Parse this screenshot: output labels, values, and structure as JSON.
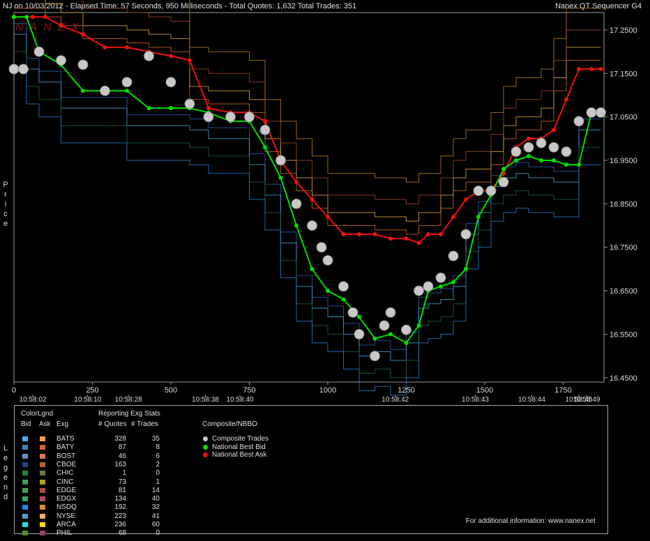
{
  "header": {
    "left": "NJ on 10/03/2012  -  Elapsed Time: 57 Seconds, 950 Milliseconds  -  Total Quotes: 1,632  Total Trades: 351",
    "right": "Nanex QT Sequencer G4"
  },
  "watermark": "NANEX",
  "side_labels": {
    "price": "P\nr\ni\nc\ne",
    "legend": "L\ne\ng\ne\nn\nd"
  },
  "colors": {
    "bid_line": "#3a7fd0",
    "ask_line": "#d86a2a",
    "trade_dot": "#c8c8c8",
    "best_bid": "#00e000",
    "best_ask": "#ee1010",
    "background": "#000000",
    "grid": "#3a3a3a"
  },
  "chart_data": {
    "type": "line",
    "ylim": [
      16.44,
      17.29
    ],
    "xlim": [
      0,
      1880
    ],
    "y_ticks": [
      "17.2500",
      "17.1500",
      "17.0500",
      "16.9500",
      "16.8500",
      "16.7500",
      "16.6500",
      "16.5500",
      "16.4500"
    ],
    "y_tick_values": [
      17.25,
      17.15,
      17.05,
      16.95,
      16.85,
      16.75,
      16.65,
      16.55,
      16.45
    ],
    "x_ticks": [
      "0",
      "250",
      "500",
      "750",
      "1000",
      "1250",
      "1500",
      "1750"
    ],
    "x_tick_values": [
      0,
      250,
      500,
      750,
      1000,
      1250,
      1500,
      1750
    ],
    "time_labels": [
      "10:58:02",
      "10:58:10",
      "10:58:28",
      "10:58:38",
      "10:58:40",
      "10:58:42",
      "10:58:43",
      "10:58:44",
      "10:58:45",
      "10:58:49"
    ],
    "time_label_x": [
      60,
      235,
      365,
      610,
      720,
      1215,
      1470,
      1650,
      1800,
      1920
    ],
    "series": [
      {
        "name": "Composite Trades",
        "x": [
          0,
          30,
          80,
          150,
          220,
          290,
          360,
          430,
          500,
          560,
          620,
          690,
          750,
          800,
          850,
          900,
          950,
          980,
          1000,
          1050,
          1080,
          1100,
          1150,
          1180,
          1200,
          1250,
          1290,
          1320,
          1360,
          1400,
          1440,
          1480,
          1520,
          1560,
          1600,
          1640,
          1680,
          1720,
          1760,
          1800,
          1840,
          1870
        ],
        "y": [
          17.16,
          17.16,
          17.2,
          17.18,
          17.17,
          17.11,
          17.13,
          17.19,
          17.13,
          17.08,
          17.05,
          17.05,
          17.05,
          17.02,
          16.95,
          16.85,
          16.8,
          16.75,
          16.72,
          16.66,
          16.6,
          16.55,
          16.5,
          16.57,
          16.6,
          16.56,
          16.65,
          16.66,
          16.68,
          16.73,
          16.78,
          16.88,
          16.88,
          16.9,
          16.97,
          16.98,
          16.99,
          16.98,
          16.97,
          17.04,
          17.06,
          17.06
        ]
      },
      {
        "name": "National Best Bid",
        "x": [
          0,
          40,
          80,
          150,
          220,
          290,
          360,
          430,
          500,
          560,
          620,
          690,
          750,
          800,
          850,
          900,
          950,
          1000,
          1050,
          1100,
          1150,
          1200,
          1250,
          1290,
          1320,
          1360,
          1400,
          1440,
          1480,
          1520,
          1560,
          1600,
          1640,
          1680,
          1720,
          1760,
          1800,
          1840,
          1870
        ],
        "y": [
          17.28,
          17.28,
          17.2,
          17.17,
          17.11,
          17.11,
          17.11,
          17.07,
          17.07,
          17.07,
          17.06,
          17.04,
          17.04,
          16.98,
          16.91,
          16.8,
          16.7,
          16.65,
          16.63,
          16.59,
          16.54,
          16.55,
          16.53,
          16.57,
          16.65,
          16.66,
          16.67,
          16.7,
          16.82,
          16.87,
          16.93,
          16.95,
          16.96,
          16.95,
          16.95,
          16.94,
          16.94,
          17.06,
          17.06
        ]
      },
      {
        "name": "National Best Ask",
        "x": [
          0,
          60,
          100,
          150,
          220,
          290,
          360,
          430,
          500,
          560,
          620,
          690,
          750,
          800,
          850,
          900,
          950,
          1000,
          1050,
          1100,
          1150,
          1200,
          1250,
          1290,
          1320,
          1360,
          1400,
          1440,
          1480,
          1520,
          1560,
          1600,
          1640,
          1680,
          1720,
          1760,
          1800,
          1840,
          1870
        ],
        "y": [
          17.28,
          17.28,
          17.28,
          17.26,
          17.24,
          17.21,
          17.21,
          17.2,
          17.19,
          17.18,
          17.07,
          17.06,
          17.06,
          17.04,
          16.95,
          16.9,
          16.86,
          16.82,
          16.78,
          16.78,
          16.78,
          16.77,
          16.77,
          16.76,
          16.78,
          16.78,
          16.82,
          16.86,
          16.88,
          16.88,
          16.92,
          16.98,
          17.0,
          17.0,
          17.02,
          17.09,
          17.16,
          17.16,
          17.16
        ]
      }
    ]
  },
  "legend": {
    "col_headers": {
      "colorlgnd": "ColorLgnd",
      "bid": "Bid",
      "ask": "Ask",
      "exg": "Exg",
      "reporting": "Reporting Exg Stats",
      "quotes": "# Quotes",
      "trades": "# Trades",
      "composite": "Composite/NBBO"
    },
    "rows": [
      {
        "exg": "BATS",
        "quotes": "328",
        "trades": "35",
        "bid_color": "#55aaee",
        "ask_color": "#f0a050"
      },
      {
        "exg": "BATY",
        "quotes": "87",
        "trades": "8",
        "bid_color": "#4480b8",
        "ask_color": "#d06030"
      },
      {
        "exg": "BOST",
        "quotes": "46",
        "trades": "6",
        "bid_color": "#6690c0",
        "ask_color": "#e07060"
      },
      {
        "exg": "CBOE",
        "quotes": "163",
        "trades": "2",
        "bid_color": "#224488",
        "ask_color": "#a86820"
      },
      {
        "exg": "CHIC",
        "quotes": "1",
        "trades": "0",
        "bid_color": "#22883a",
        "ask_color": "#6a7a3a"
      },
      {
        "exg": "CINC",
        "quotes": "73",
        "trades": "1",
        "bid_color": "#3aa060",
        "ask_color": "#b0a020"
      },
      {
        "exg": "EDGE",
        "quotes": "81",
        "trades": "14",
        "bid_color": "#44a050",
        "ask_color": "#a05040"
      },
      {
        "exg": "EDGX",
        "quotes": "134",
        "trades": "40",
        "bid_color": "#33aa66",
        "ask_color": "#b04a60"
      },
      {
        "exg": "NSDQ",
        "quotes": "192",
        "trades": "32",
        "bid_color": "#2288dd",
        "ask_color": "#e08a30"
      },
      {
        "exg": "NYSE",
        "quotes": "223",
        "trades": "41",
        "bid_color": "#5599cc",
        "ask_color": "#ffb060"
      },
      {
        "exg": "ARCA",
        "quotes": "236",
        "trades": "60",
        "bid_color": "#22ddee",
        "ask_color": "#eedd00"
      },
      {
        "exg": "PHIL",
        "quotes": "68",
        "trades": "0",
        "bid_color": "#558833",
        "ask_color": "#884466"
      }
    ],
    "nbbo": [
      {
        "label": "Composite Trades",
        "color": "#c8c8c8"
      },
      {
        "label": "National Best Bid",
        "color": "#00e000"
      },
      {
        "label": "National Best Ask",
        "color": "#ee1010"
      }
    ],
    "footer": "For additional information: www.nanex.net"
  }
}
